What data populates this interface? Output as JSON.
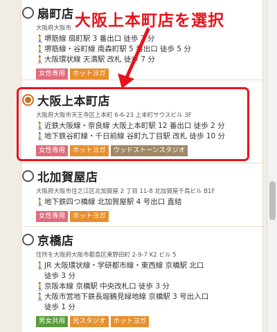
{
  "annotation": {
    "callout_text": "大阪上本町店を選択"
  },
  "stores": [
    {
      "name": "扇町店",
      "address": "大阪府大阪市",
      "access": [
        "堺筋線 扇町駅 3 番出口 徒歩 2 分",
        "堺筋線・谷町線 南森町駅 5 番出口 徒歩 5 分",
        "大阪環状線 天満駅 改札 徒歩 7 分"
      ],
      "tags": [
        "女性専用",
        "ホットヨガ"
      ],
      "selected": false
    },
    {
      "name": "大阪上本町店",
      "address": "大阪府大阪市天王寺区上本町 6-6-23 上本町サウスビル 3F",
      "access": [
        "近鉄大阪線・奈良線 大阪上本町駅 12 番出口 徒歩 2 分",
        "地下鉄谷町線・千日前線 谷町九丁目駅 改札 徒歩 10 分"
      ],
      "tags": [
        "女性専用",
        "ホットヨガ",
        "ウッドストーンスタジオ"
      ],
      "selected": true
    },
    {
      "name": "北加賀屋店",
      "address": "大阪府大阪市住之江区北加賀屋 2 丁目 11-8 北加賀屋千鳥ビル B1F",
      "access": [
        "地下鉄四つ橋線 北加賀屋駅 4 号出口 直結"
      ],
      "tags": [
        "女性専用",
        "ホットヨガ"
      ],
      "selected": false
    },
    {
      "name": "京橋店",
      "address": "住所を大阪府大阪市都島区東野田町 2-9-7 K2 ビル 5",
      "access": [
        "JR 大阪環状線・学研都市線・東西線 京橋駅 北口",
        "徒歩 3 分",
        "京阪本線 京橋駅 中央改札口 徒歩 3 分",
        "大阪市営地下鉄長堀鶴見緑地線 京橋駅 3 号出入口",
        "徒歩 1 分"
      ],
      "tags": [
        "男女共用",
        "光スタジオ",
        "ホットヨガ"
      ],
      "selected": false
    }
  ],
  "colors": {
    "accent_red": "#e8131c",
    "tag_pink": "#e06b7c",
    "tag_orange": "#e8902e",
    "tag_brown": "#a08866",
    "tag_green": "#5a9b3d"
  }
}
